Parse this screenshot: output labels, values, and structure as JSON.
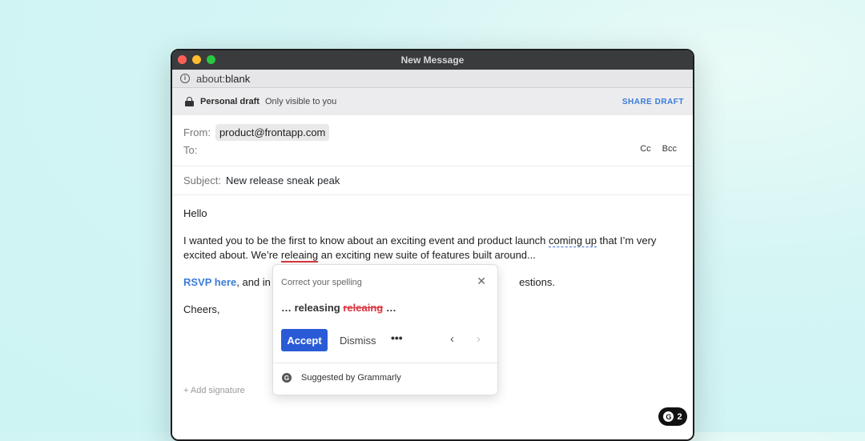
{
  "window": {
    "title": "New Message"
  },
  "urlbar": {
    "prefix": "about:",
    "address": "blank"
  },
  "draftbar": {
    "label": "Personal draft",
    "sublabel": "Only visible to you",
    "share": "SHARE DRAFT"
  },
  "compose": {
    "from_label": "From:",
    "from_value": "product@frontapp.com",
    "to_label": "To:",
    "cc": "Cc",
    "bcc": "Bcc",
    "subject_label": "Subject:",
    "subject_value": "New release sneak peak",
    "greeting": "Hello",
    "p1_a": "I wanted you to be the first to know about an exciting event and product launch ",
    "p1_link": "coming up",
    "p1_b": " that I’m very excited about. We’re ",
    "p1_err": "releaing",
    "p1_c": " an exciting new suite of features built around...",
    "rsvp": "RSVP here",
    "p2_a": ", and in t",
    "p2_b": "estions.",
    "closing": "Cheers,",
    "add_signature": "+ Add signature"
  },
  "popup": {
    "header": "Correct your spelling",
    "prefix": "… ",
    "suggestion": "releasing",
    "original": "releaing",
    "suffix": " …",
    "accept": "Accept",
    "dismiss": "Dismiss",
    "more": "•••",
    "footer": "Suggested by Grammarly"
  },
  "badge": {
    "count": "2"
  },
  "icons": {
    "info": "info-icon",
    "lock": "lock-icon",
    "close": "close-icon",
    "prev": "chevron-left-icon",
    "next": "chevron-right-icon",
    "grammarly": "grammarly-icon"
  },
  "colors": {
    "accent": "#2a5bd7",
    "link": "#3b7bd9",
    "error": "#d9363e"
  }
}
